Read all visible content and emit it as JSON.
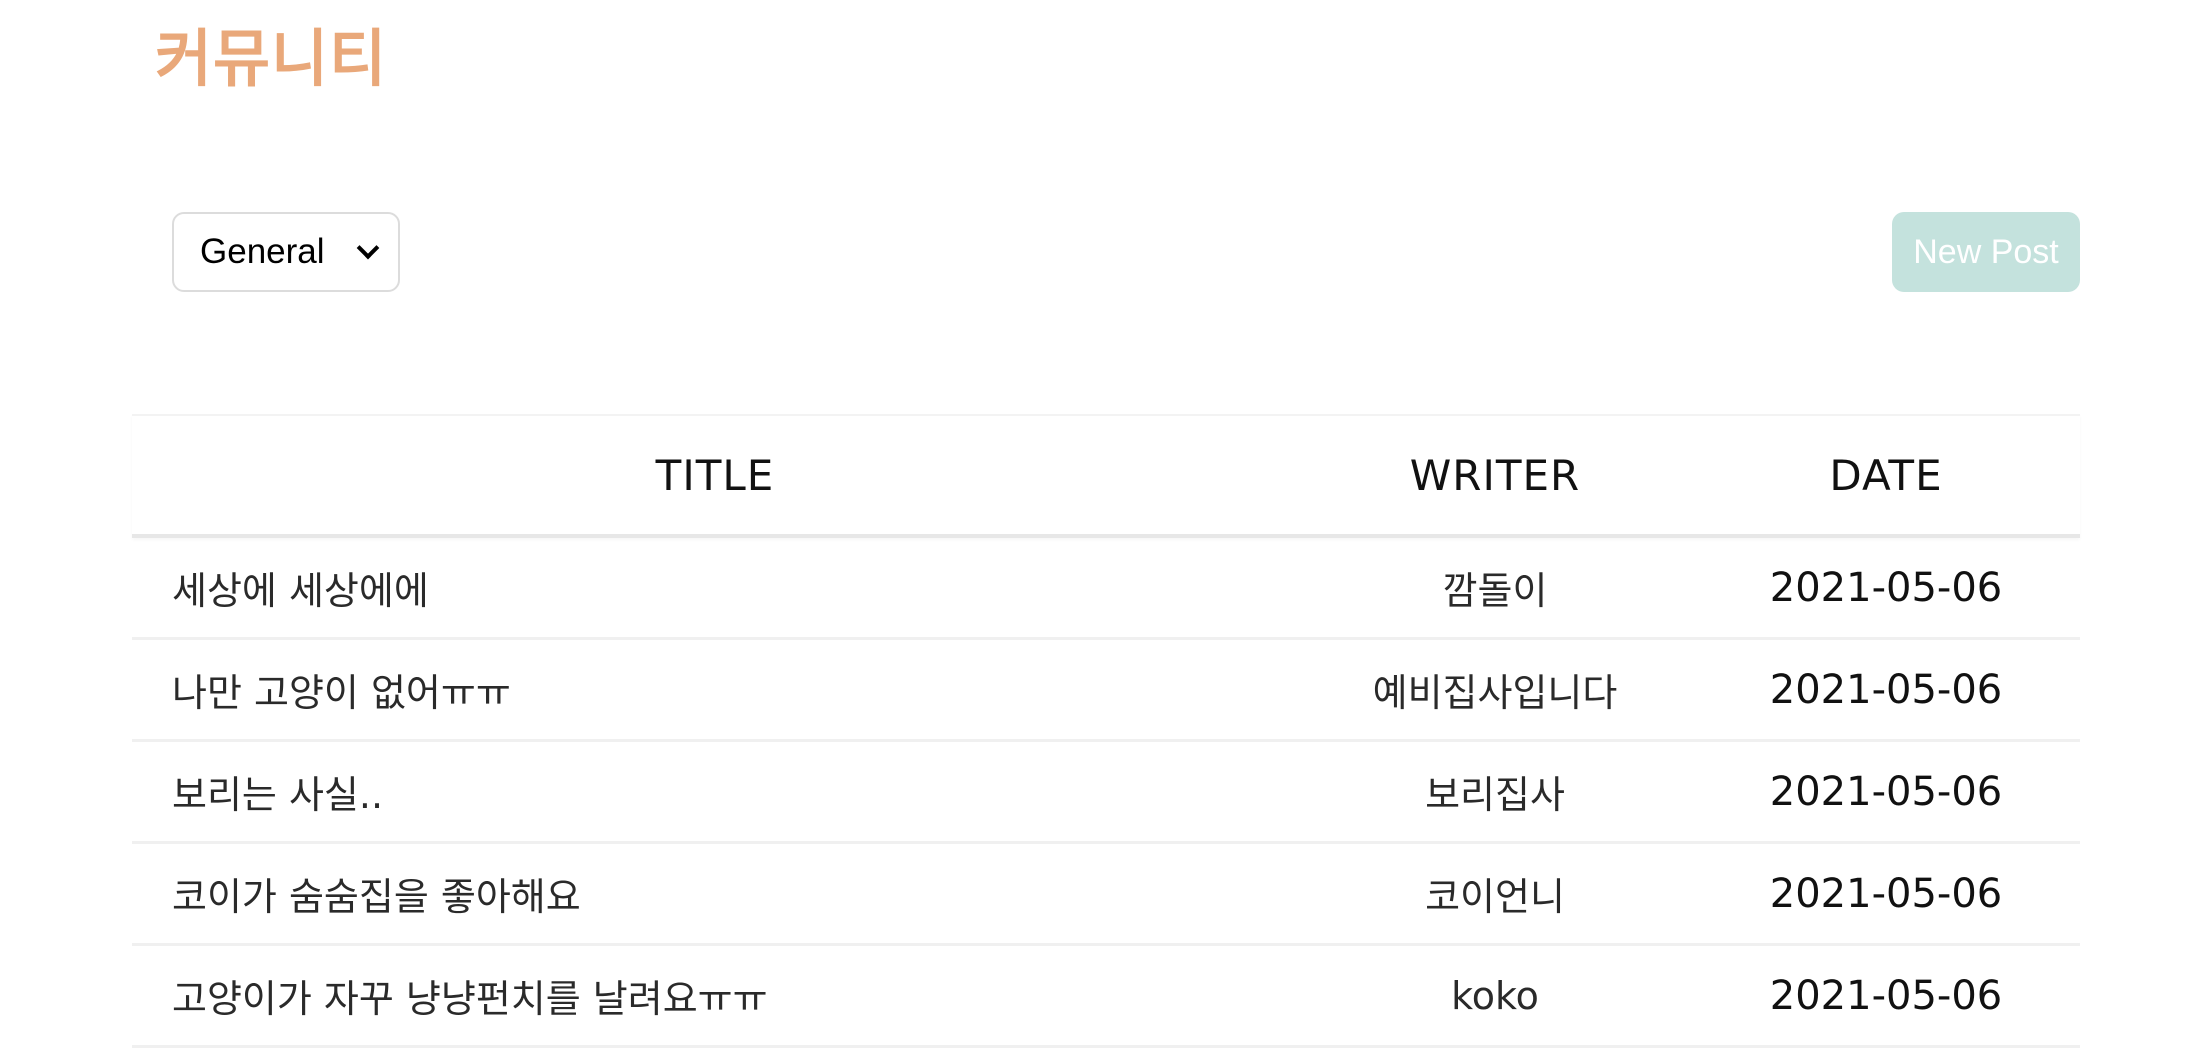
{
  "page": {
    "title": "커뮤니티"
  },
  "controls": {
    "category_selected": "General",
    "new_post_label": "New Post"
  },
  "table": {
    "headers": {
      "title": "TITLE",
      "writer": "WRITER",
      "date": "DATE"
    },
    "rows": [
      {
        "title": "세상에 세상에에",
        "writer": "깜돌이",
        "date": "2021-05-06"
      },
      {
        "title": "나만 고양이 없어ㅠㅠ",
        "writer": "예비집사입니다",
        "date": "2021-05-06"
      },
      {
        "title": "보리는 사실..",
        "writer": "보리집사",
        "date": "2021-05-06"
      },
      {
        "title": "코이가 숨숨집을 좋아해요",
        "writer": "코이언니",
        "date": "2021-05-06"
      },
      {
        "title": "고양이가 자꾸 냥냥펀치를 날려요ㅠㅠ",
        "writer": "koko",
        "date": "2021-05-06"
      }
    ]
  },
  "colors": {
    "title_accent": "#e9a87a",
    "button_bg": "#c4e2dd"
  }
}
